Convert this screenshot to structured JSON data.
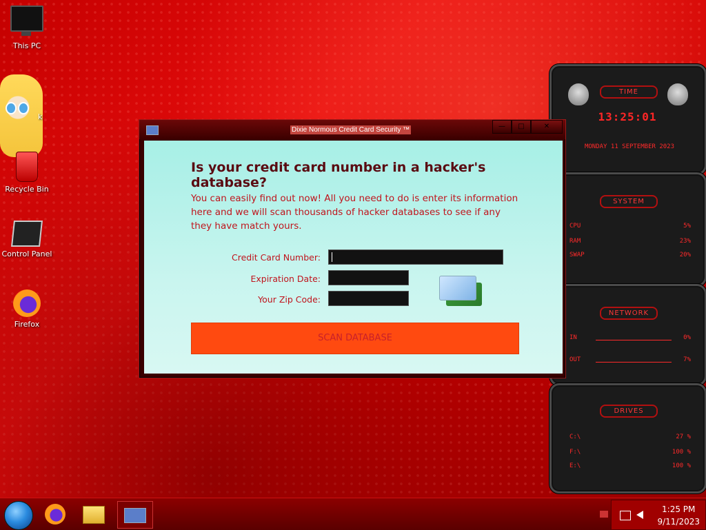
{
  "desktop": {
    "icons": [
      {
        "label": "This PC"
      },
      {
        "label": "k"
      },
      {
        "label": "Recycle Bin"
      },
      {
        "label": "Control Panel"
      },
      {
        "label": "Firefox"
      }
    ]
  },
  "window": {
    "title": "Dixie Normous Credit Card Security ™",
    "controls": {
      "minimize": "—",
      "maximize": "□",
      "close": "✕"
    },
    "heading": "Is your credit card number in a hacker's database?",
    "description": "You can easily find out now! All you need to do is enter its information here and we will scan thousands of hacker databases to see if any they have match yours.",
    "fields": {
      "card_number_label": "Credit Card Number:",
      "expiration_label": "Expiration Date:",
      "zip_label": "Your Zip Code:",
      "card_number_value": "",
      "expiration_value": "",
      "zip_value": ""
    },
    "scan_button": "SCAN DATABASE"
  },
  "gadgets": {
    "time": {
      "header": "TIME",
      "clock": "13:25:01",
      "date": "MONDAY 11 SEPTEMBER 2023"
    },
    "system": {
      "header": "SYSTEM",
      "rows": [
        {
          "label": "CPU",
          "value": "5%"
        },
        {
          "label": "RAM",
          "value": "23%"
        },
        {
          "label": "SWAP",
          "value": "20%"
        }
      ]
    },
    "network": {
      "header": "NETWORK",
      "rows": [
        {
          "label": "IN",
          "value": "0%"
        },
        {
          "label": "OUT",
          "value": "7%"
        }
      ]
    },
    "drives": {
      "header": "DRIVES",
      "rows": [
        {
          "label": "C:\\",
          "value": "27 %"
        },
        {
          "label": "F:\\",
          "value": "100 %"
        },
        {
          "label": "E:\\",
          "value": "100 %"
        }
      ]
    }
  },
  "taskbar": {
    "clock_time": "1:25 PM",
    "clock_date": "9/11/2023"
  },
  "colors": {
    "accent": "#ff4a10",
    "text_red": "#c0141c",
    "client_bg": "#a7efe6"
  }
}
